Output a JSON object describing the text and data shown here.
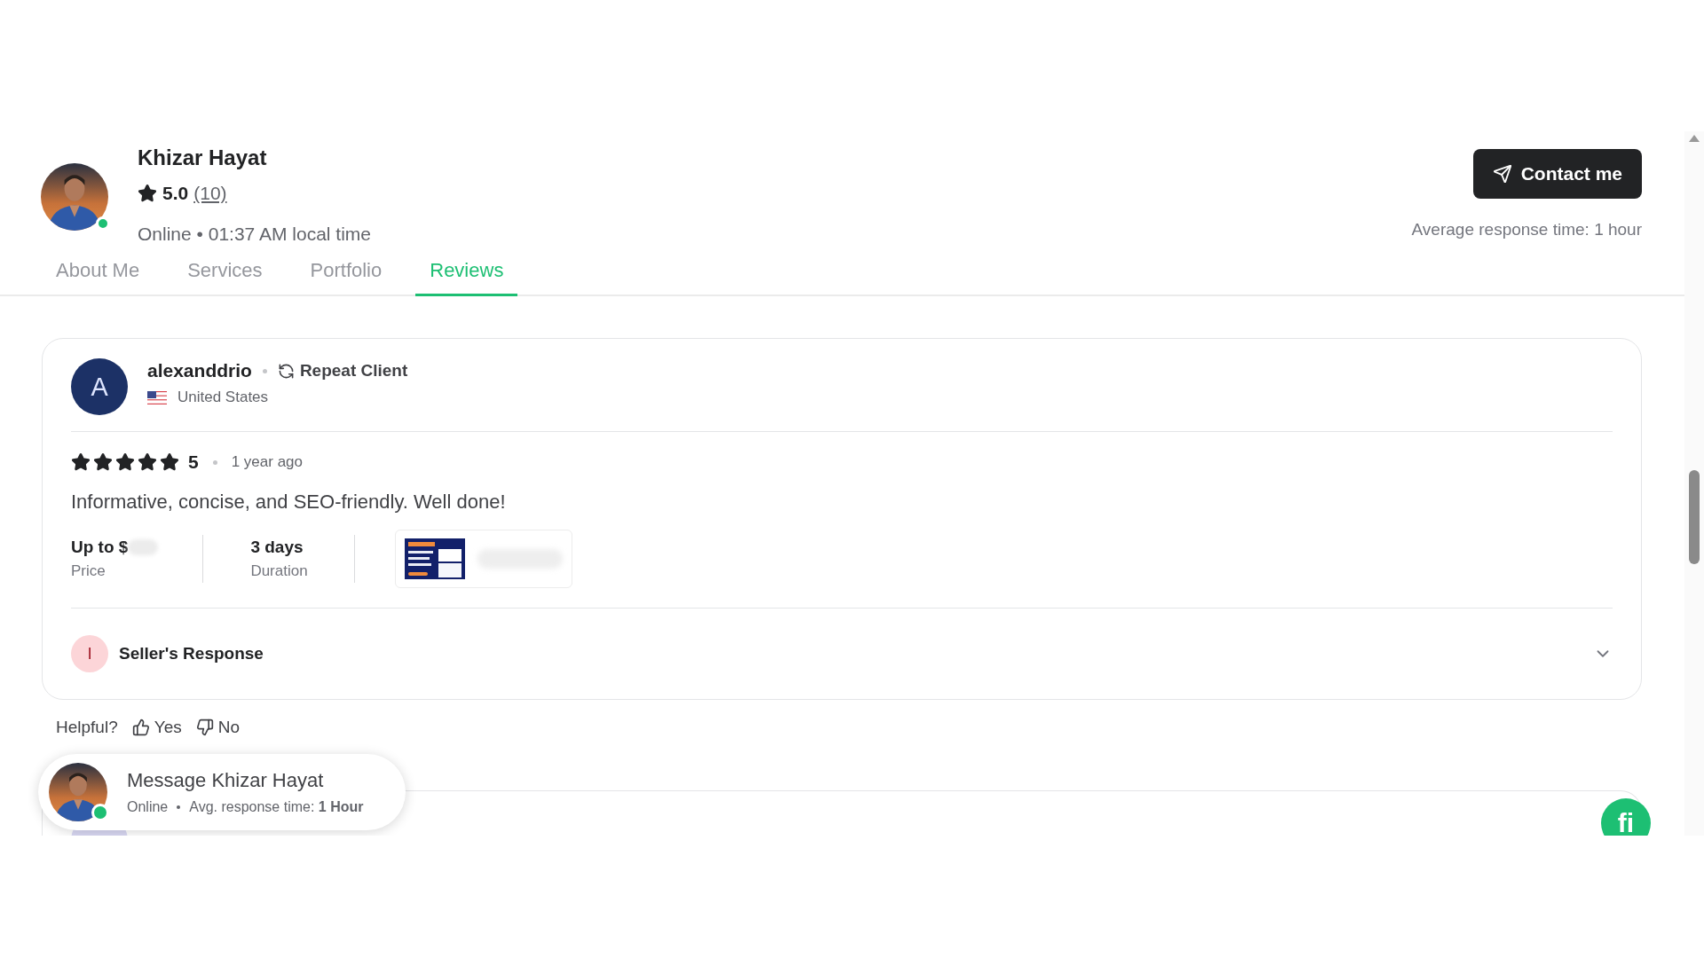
{
  "profile": {
    "name": "Khizar Hayat",
    "rating": "5.0",
    "review_count": "(10)",
    "status": "Online • 01:37 AM local time",
    "online": true
  },
  "contact_button": "Contact me",
  "avg_response": "Average response time: 1 hour",
  "tabs": [
    {
      "label": "About Me",
      "selected": false
    },
    {
      "label": "Services",
      "selected": false
    },
    {
      "label": "Portfolio",
      "selected": false
    },
    {
      "label": "Reviews",
      "selected": true
    }
  ],
  "review": {
    "avatar_letter": "A",
    "username": "alexanddrio",
    "badge": "Repeat Client",
    "country": "United States",
    "stars": 5,
    "score": "5",
    "time": "1 year ago",
    "text": "Informative, concise, and SEO-friendly. Well done!",
    "price": "Up to $",
    "price_label": "Price",
    "duration": "3 days",
    "duration_label": "Duration",
    "response_avatar_letter": "I",
    "response_label": "Seller's Response",
    "response_expanded": false
  },
  "helpful": {
    "label": "Helpful?",
    "yes": "Yes",
    "no": "No"
  },
  "message_popup": {
    "title": "Message Khizar Hayat",
    "status": "Online",
    "response": "Avg. response time: **1 Hour**",
    "online": true
  },
  "chat_badge": "fi"
}
